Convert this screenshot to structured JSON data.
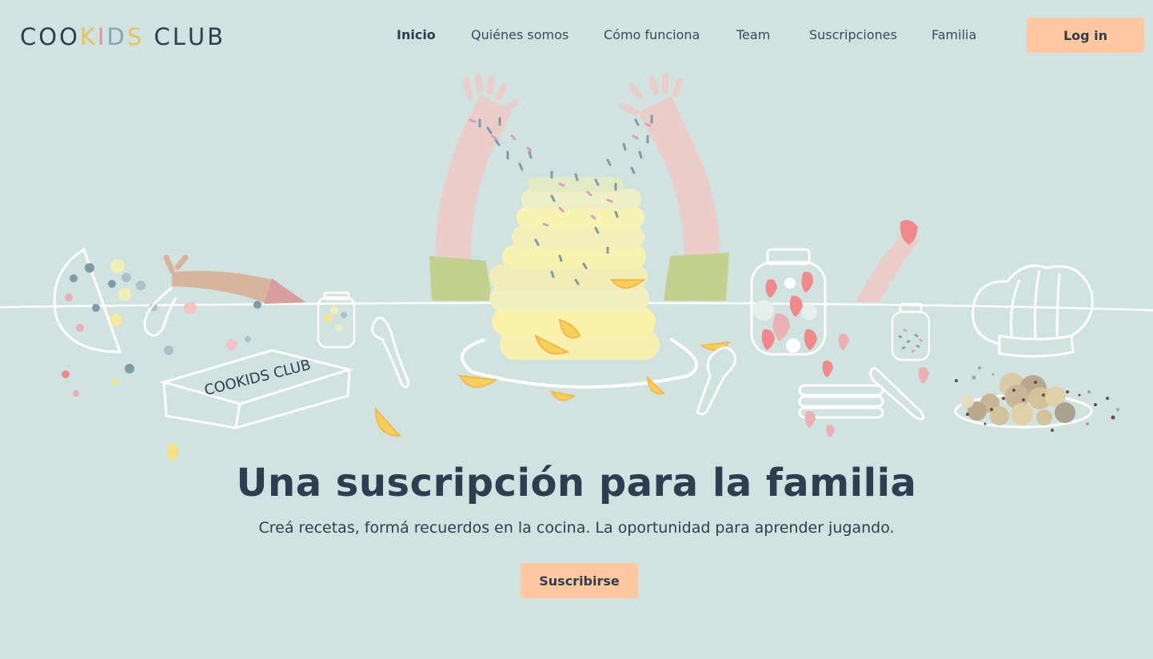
{
  "brand": {
    "name": "COOKIDS CLUB",
    "letters": [
      {
        "ch": "C",
        "color": "#2c3e50"
      },
      {
        "ch": "O",
        "color": "#2c3e50"
      },
      {
        "ch": "O",
        "color": "#2c3e50"
      },
      {
        "ch": "K",
        "color": "#e8c25a"
      },
      {
        "ch": "I",
        "color": "#e88f9a"
      },
      {
        "ch": "D",
        "color": "#7fa9b8"
      },
      {
        "ch": "S",
        "color": "#e8c25a"
      },
      {
        "ch": " ",
        "color": "#2c3e50"
      },
      {
        "ch": "C",
        "color": "#2c3e50"
      },
      {
        "ch": "L",
        "color": "#2c3e50"
      },
      {
        "ch": "U",
        "color": "#2c3e50"
      },
      {
        "ch": "B",
        "color": "#2c3e50"
      }
    ]
  },
  "nav": {
    "items": [
      {
        "label": "Inicio",
        "active": true
      },
      {
        "label": "Quiénes somos",
        "active": false
      },
      {
        "label": "Cómo funciona",
        "active": false
      },
      {
        "label": "Team",
        "active": false
      },
      {
        "label": "Suscripciones",
        "active": false
      },
      {
        "label": "Familia",
        "active": false
      }
    ],
    "login_label": "Log in"
  },
  "hero": {
    "title": "Una suscripción para la familia",
    "subtitle": "Creá recetas, formá recuerdos en la cocina. La oportunidad para aprender jugando.",
    "cta_label": "Suscribirse",
    "box_label": "COOKIDS CLUB"
  },
  "colors": {
    "background": "#d0e3e0",
    "accent": "#ffc89f",
    "text": "#2c3e50"
  }
}
